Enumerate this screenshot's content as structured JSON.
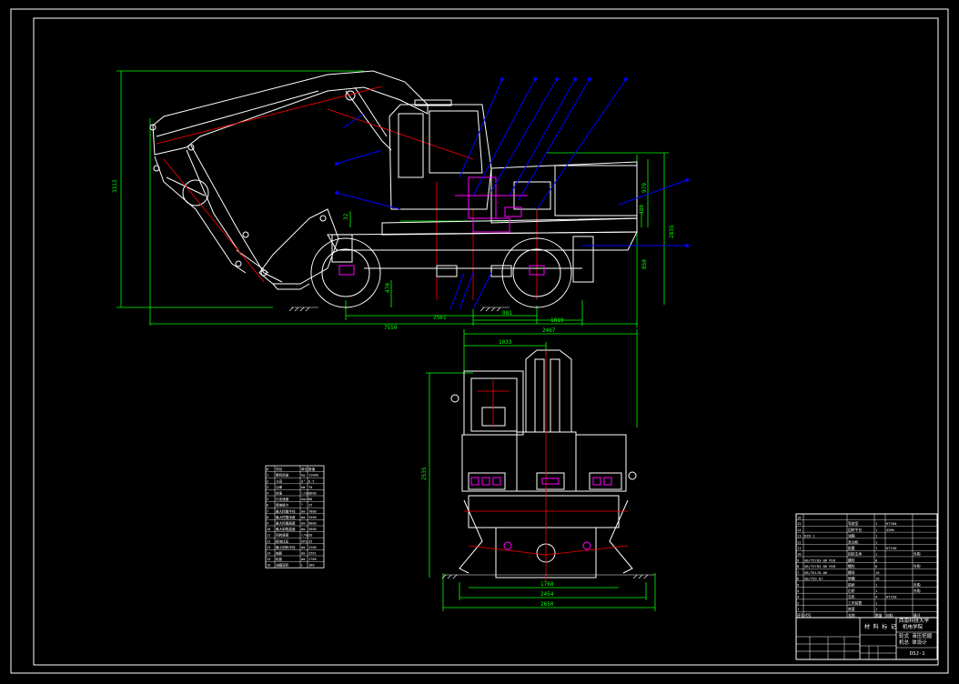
{
  "colors": {
    "background": "#000000",
    "frame": "#ffffff",
    "dimension": "#00ff00",
    "outline": "#ffffff",
    "leader": "#0000ff",
    "centerline": "#ff0000",
    "hydraulic": "#ff00ff",
    "yellow": "#ffff00",
    "cyan": "#00ffff"
  },
  "side_view": {
    "dims": {
      "overall_length": "7550",
      "overall_height": "3313",
      "height_right": "2835",
      "height_upper": "979",
      "height_mid": "480",
      "height_lower": "850",
      "wheelbase": "2561",
      "axle_a": "981",
      "axle_b": "1019",
      "clearance": "470",
      "pin": "32"
    }
  },
  "front_view": {
    "dims": {
      "top_width": "2467",
      "half_width": "1033",
      "height": "2535",
      "track": "1768",
      "width_mid": "2454",
      "width_bottom": "2650"
    }
  },
  "spec_table": {
    "rows": [
      [
        "#",
        "项目",
        "单位",
        "数值"
      ],
      [
        "1",
        "整机质量",
        "kg",
        "12000"
      ],
      [
        "2",
        "斗容",
        "m³",
        "0.5"
      ],
      [
        "3",
        "功率",
        "kW",
        "70"
      ],
      [
        "4",
        "转速",
        "r/min",
        "2200"
      ],
      [
        "5",
        "行走速度",
        "km/h",
        "30"
      ],
      [
        "6",
        "爬坡能力",
        "°",
        "25"
      ],
      [
        "7",
        "最大挖掘半径",
        "mm",
        "7800"
      ],
      [
        "8",
        "最大挖掘深度",
        "mm",
        "3500"
      ],
      [
        "9",
        "最大挖掘高度",
        "mm",
        "8000"
      ],
      [
        "10",
        "最大卸载高度",
        "mm",
        "5600"
      ],
      [
        "11",
        "回转速度",
        "r/min",
        "11"
      ],
      [
        "12",
        "接地比压",
        "kPa",
        "35"
      ],
      [
        "13",
        "最小回转半径",
        "mm",
        "2200"
      ],
      [
        "14",
        "轴距",
        "mm",
        "2561"
      ],
      [
        "15",
        "轮距",
        "mm",
        "1768"
      ],
      [
        "16",
        "油箱容积",
        "L",
        "160"
      ]
    ]
  },
  "title_block": {
    "material_label": "材 料 标 记",
    "university": "西南科技大学",
    "school": "机电学院",
    "title_line1": "轮式 液压挖掘",
    "title_line2": "机总 体设计",
    "drawing_no": "DSJ-1",
    "parts_rows": [
      [
        "16",
        "",
        "",
        "",
        "",
        ""
      ],
      [
        "15",
        "",
        "驾驶室",
        "1",
        "HT200",
        ""
      ],
      [
        "14",
        "",
        "回转平台",
        "1",
        "45Mn",
        ""
      ],
      [
        "13",
        "DZH-1",
        "油箱",
        "1",
        "",
        ""
      ],
      [
        "12",
        "",
        "发动机",
        "1",
        "",
        ""
      ],
      [
        "11",
        "",
        "配重",
        "1",
        "HT150",
        ""
      ],
      [
        "10",
        "",
        "回转支承",
        "1",
        "",
        "外购"
      ],
      [
        "9",
        "GB/T5783-86 M16",
        "螺栓",
        "8",
        "",
        ""
      ],
      [
        "8",
        "GB/T5783-86 M20",
        "螺栓",
        "8",
        "",
        "外购"
      ],
      [
        "7",
        "GB/T6170-86",
        "螺母",
        "16",
        "",
        ""
      ],
      [
        "6",
        "GB/T93-87",
        "垫圈",
        "16",
        "",
        ""
      ],
      [
        "5",
        "",
        "前桥",
        "1",
        "",
        "外购"
      ],
      [
        "4",
        "",
        "后桥",
        "1",
        "",
        "外购"
      ],
      [
        "3",
        "",
        "车轮",
        "4",
        "HT250",
        ""
      ],
      [
        "2",
        "",
        "工作装置",
        "1",
        "",
        ""
      ],
      [
        "1",
        "",
        "底盘",
        "1",
        "",
        ""
      ],
      [
        "序号",
        "代号",
        "名称",
        "数量",
        "材料",
        "备注"
      ]
    ]
  }
}
